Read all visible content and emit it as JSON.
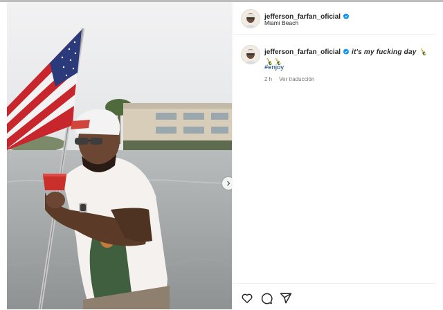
{
  "post": {
    "username": "jefferson_farfan_oficial",
    "location": "Miami Beach",
    "caption": {
      "username": "jefferson_farfan_oficial",
      "text": "it's my fucking day 🍾🍾🍾",
      "hashtag": "#enjoy",
      "time": "2 h",
      "translate_label": "Ver traducción"
    }
  },
  "icons": {
    "verified": "verified-badge-icon",
    "like": "heart-icon",
    "comment": "comment-bubble-icon",
    "share": "paper-plane-icon",
    "next": "chevron-right-icon"
  },
  "colors": {
    "verified": "#0095f6",
    "hashtag": "#00376b",
    "meta": "#737373",
    "text": "#262626"
  }
}
